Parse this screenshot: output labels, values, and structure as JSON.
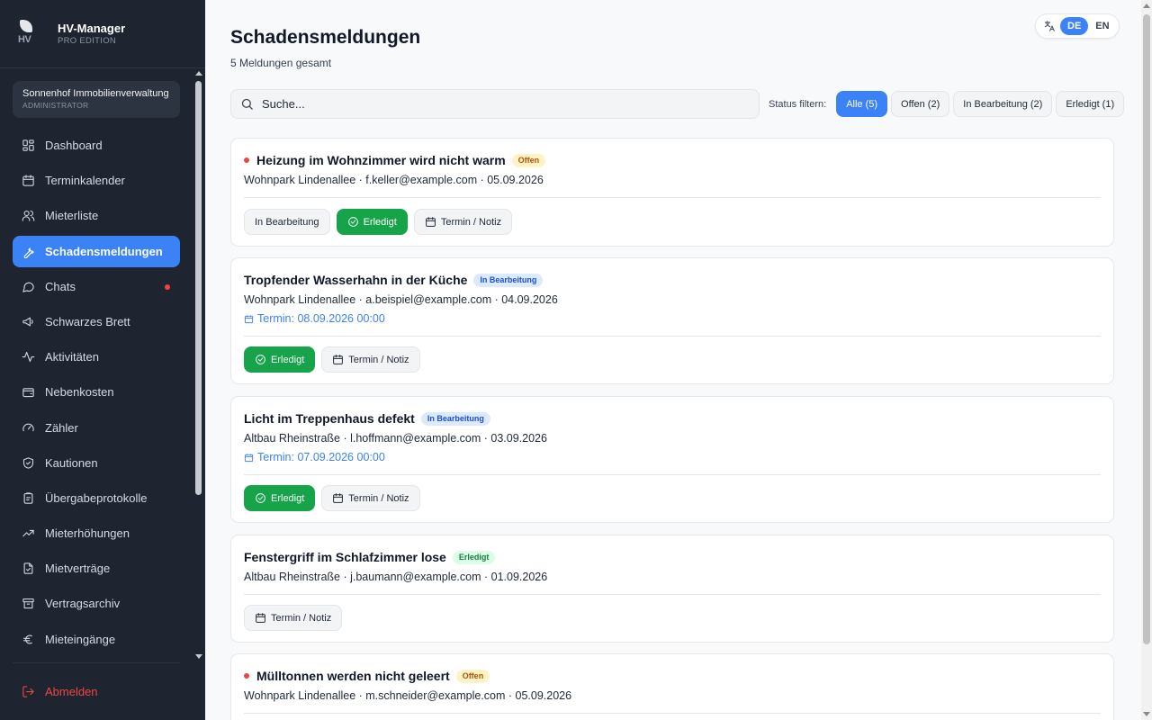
{
  "brand": {
    "logo_text": "HV",
    "title": "HV-Manager",
    "subtitle": "PRO EDITION"
  },
  "org": {
    "name": "Sonnenhof Immobilienverwaltung",
    "role": "ADMINISTRATOR"
  },
  "sidebar": {
    "items": [
      {
        "label": "Dashboard",
        "icon": "dashboard-icon"
      },
      {
        "label": "Terminkalender",
        "icon": "calendar-icon"
      },
      {
        "label": "Mieterliste",
        "icon": "users-icon"
      },
      {
        "label": "Schadensmeldungen",
        "icon": "wrench-icon",
        "active": true
      },
      {
        "label": "Chats",
        "icon": "chat-icon",
        "unread": true
      },
      {
        "label": "Schwarzes Brett",
        "icon": "megaphone-icon"
      },
      {
        "label": "Aktivitäten",
        "icon": "activity-icon"
      },
      {
        "label": "Nebenkosten",
        "icon": "wallet-icon"
      },
      {
        "label": "Zähler",
        "icon": "gauge-icon"
      },
      {
        "label": "Kautionen",
        "icon": "shield-icon"
      },
      {
        "label": "Übergabeprotokolle",
        "icon": "clipboard-icon"
      },
      {
        "label": "Mieterhöhungen",
        "icon": "trending-up-icon"
      },
      {
        "label": "Mietverträge",
        "icon": "document-icon"
      },
      {
        "label": "Vertragsarchiv",
        "icon": "archive-icon"
      },
      {
        "label": "Mieteingänge",
        "icon": "euro-icon"
      }
    ],
    "logout_label": "Abmelden"
  },
  "header": {
    "title": "Schadensmeldungen",
    "subtitle": "5 Meldungen gesamt",
    "lang_options": [
      "DE",
      "EN"
    ],
    "lang_active": "DE"
  },
  "search": {
    "placeholder": "Suche..."
  },
  "filters": {
    "label": "Status filtern:",
    "options": [
      "Alle (5)",
      "Offen (2)",
      "In Bearbeitung (2)",
      "Erledigt (1)"
    ],
    "active": "Alle (5)"
  },
  "reports": [
    {
      "title": "Heizung im Wohnzimmer wird nicht warm",
      "status": "Offen",
      "meta": "Wohnpark Lindenallee · f.keller@example.com · 05.09.2026",
      "termin": "",
      "actions": [
        "In Bearbeitung",
        "Erledigt",
        "Termin / Notiz"
      ]
    },
    {
      "title": "Tropfender Wasserhahn in der Küche",
      "status": "In Bearbeitung",
      "meta": "Wohnpark Lindenallee · a.beispiel@example.com · 04.09.2026",
      "termin": "Termin: 08.09.2026 00:00",
      "actions": [
        "Erledigt",
        "Termin / Notiz"
      ]
    },
    {
      "title": "Licht im Treppenhaus defekt",
      "status": "In Bearbeitung",
      "meta": "Altbau Rheinstraße · l.hoffmann@example.com · 03.09.2026",
      "termin": "Termin: 07.09.2026 00:00",
      "actions": [
        "Erledigt",
        "Termin / Notiz"
      ]
    },
    {
      "title": "Fenstergriff im Schlafzimmer lose",
      "status": "Erledigt",
      "meta": "Altbau Rheinstraße · j.baumann@example.com · 01.09.2026",
      "termin": "",
      "actions": [
        "Termin / Notiz"
      ]
    },
    {
      "title": "Mülltonnen werden nicht geleert",
      "status": "Offen",
      "meta": "Wohnpark Lindenallee · m.schneider@example.com · 05.09.2026",
      "termin": "",
      "actions": []
    }
  ],
  "colors": {
    "sidebar_bg": "#1e2530",
    "accent": "#3b82f6",
    "success": "#16a34a",
    "danger": "#ef4444"
  }
}
